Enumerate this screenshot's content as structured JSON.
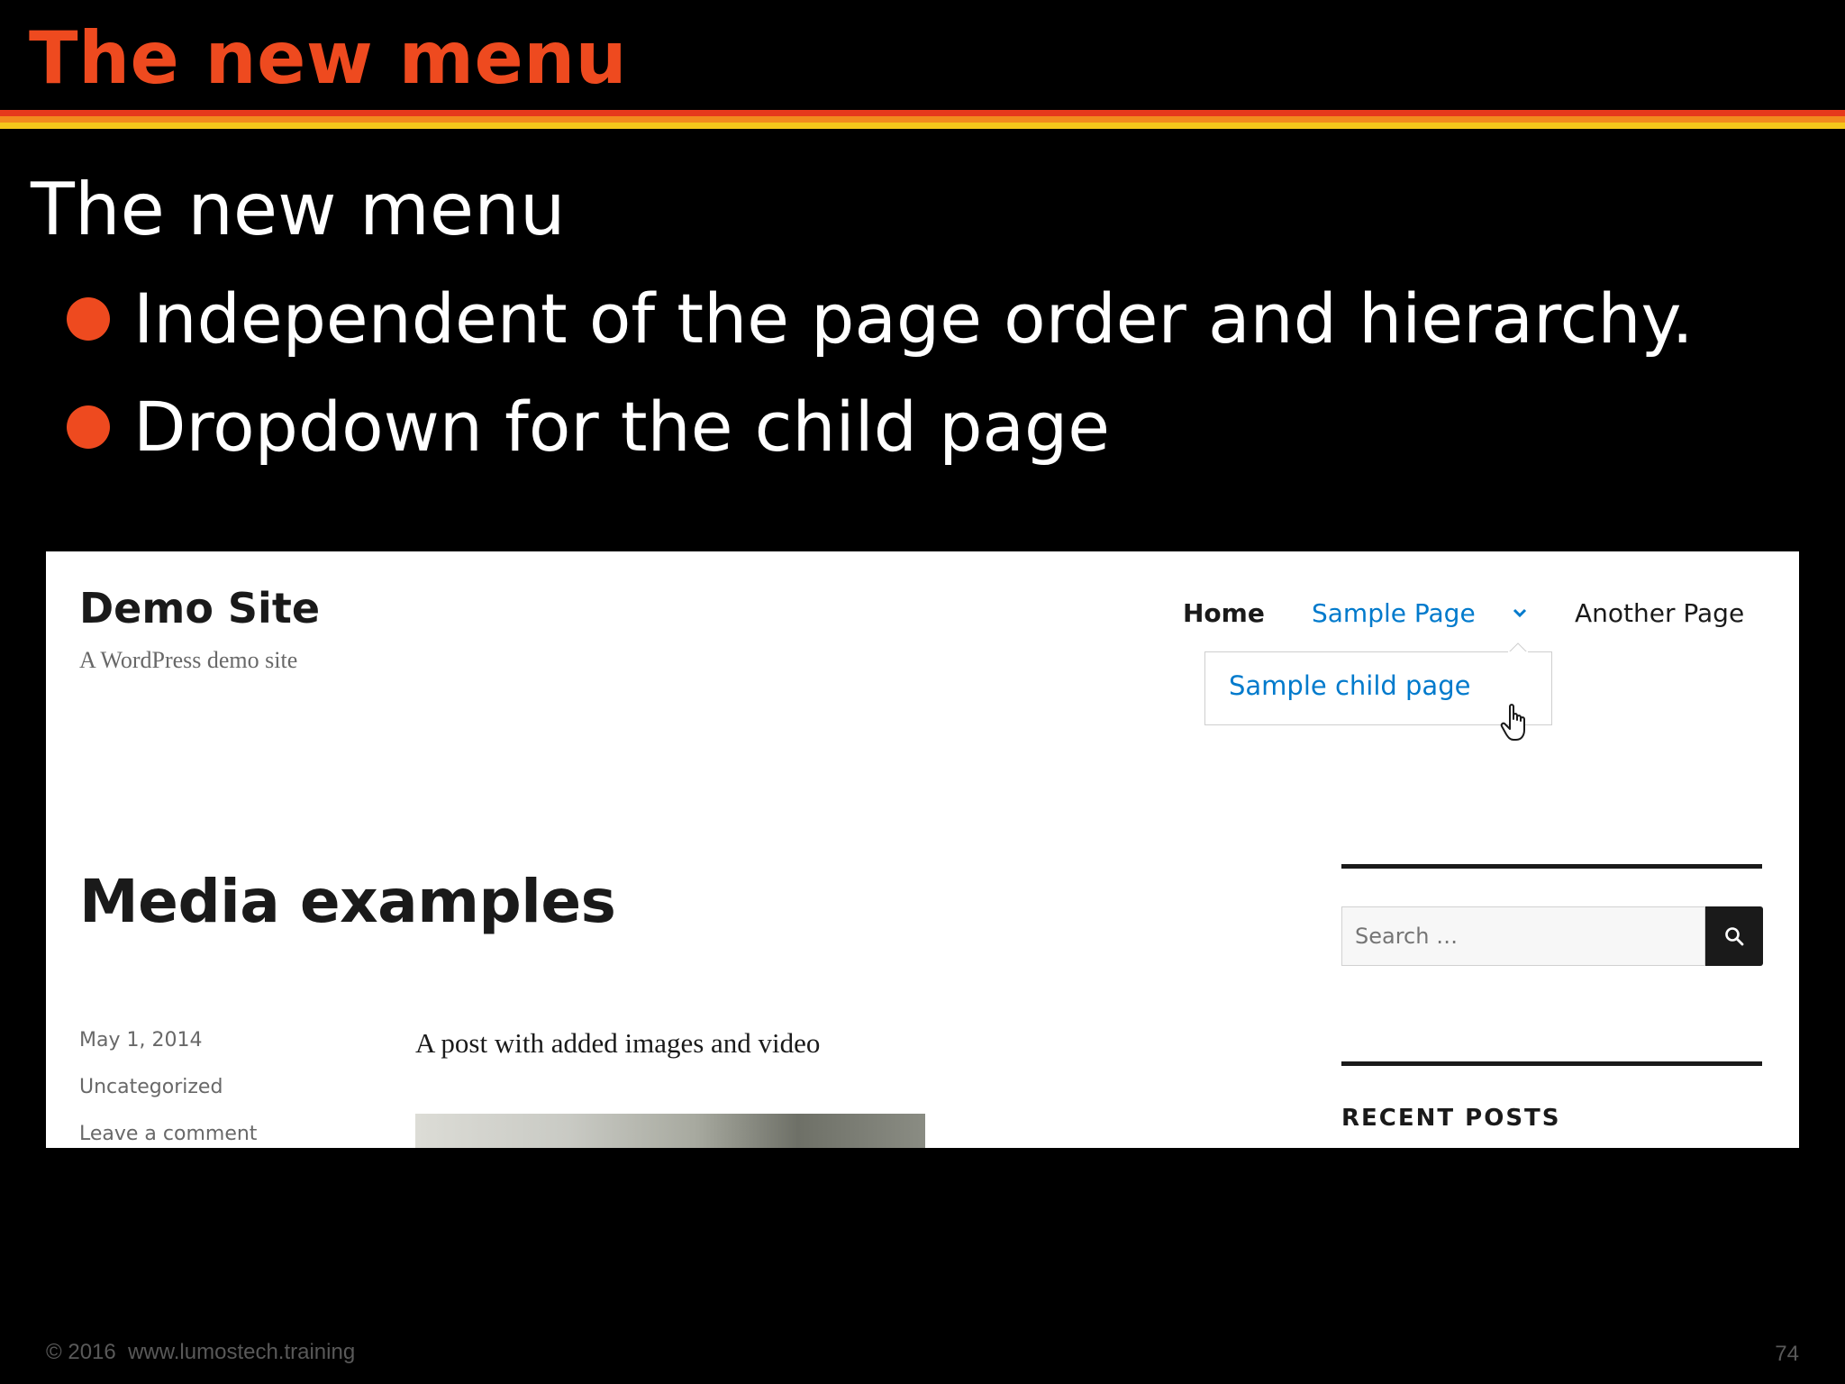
{
  "slide": {
    "title": "The new menu",
    "heading": "The new menu",
    "bullets": [
      "Independent of the page order and hierarchy.",
      "Dropdown for the child page"
    ],
    "footer_copyright": "© 2016  www.lumostech.training",
    "page_number": "74"
  },
  "site": {
    "title": "Demo Site",
    "tagline": "A WordPress demo site"
  },
  "nav": {
    "items": [
      "Home",
      "Sample Page",
      "Another Page"
    ],
    "dropdown_items": [
      "Sample child page"
    ]
  },
  "post": {
    "title": "Media examples",
    "date": "May 1, 2014",
    "category": "Uncategorized",
    "comment_link": "Leave a comment",
    "excerpt": "A post with added images and video"
  },
  "sidebar": {
    "search_placeholder": "Search …",
    "recent_posts_heading": "RECENT POSTS"
  },
  "icons": {
    "nav_dropdown": "chevron-down-icon",
    "search": "search-icon",
    "cursor": "hand-pointer-icon",
    "bullet": "bullet-dot-icon"
  },
  "colors": {
    "accent": "#ee4a1f",
    "stripe_red": "#e6391c",
    "stripe_orange": "#f28a1e",
    "stripe_yellow": "#f5c71a",
    "link": "#007acc",
    "background": "#000000"
  }
}
